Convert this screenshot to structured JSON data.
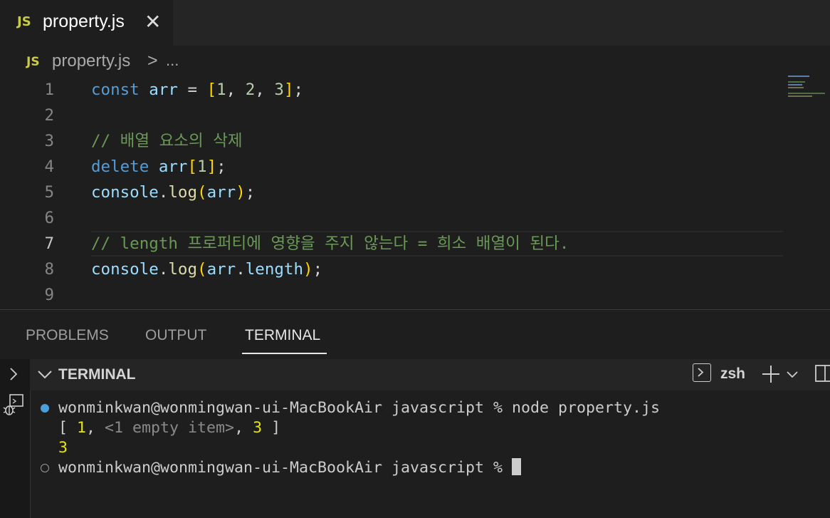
{
  "tab": {
    "badge": "JS",
    "filename": "property.js"
  },
  "breadcrumb": {
    "badge": "JS",
    "file": "property.js",
    "separator": ">",
    "more": "..."
  },
  "editor": {
    "line_numbers": [
      "1",
      "2",
      "3",
      "4",
      "5",
      "6",
      "7",
      "8",
      "9"
    ],
    "active_line": "7",
    "lines": {
      "l1": {
        "kw": "const",
        "var": "arr",
        "op": " = ",
        "b1": "[",
        "n1": "1",
        "c1": ", ",
        "n2": "2",
        "c2": ", ",
        "n3": "3",
        "b2": "]",
        "semi": ";"
      },
      "l3": {
        "comment": "// 배열 요소의 삭제"
      },
      "l4": {
        "kw": "delete",
        "var": "arr",
        "b1": "[",
        "n1": "1",
        "b2": "]",
        "semi": ";"
      },
      "l5": {
        "obj": "console",
        "dot": ".",
        "fn": "log",
        "b1": "(",
        "arg": "arr",
        "b2": ")",
        "semi": ";"
      },
      "l7": {
        "comment": "// length 프로퍼티에 영향을 주지 않는다 = 희소 배열이 된다."
      },
      "l8": {
        "obj": "console",
        "dot": ".",
        "fn": "log",
        "b1": "(",
        "arg": "arr",
        "dot2": ".",
        "prop": "length",
        "b2": ")",
        "semi": ";"
      }
    }
  },
  "panel": {
    "tabs": {
      "problems": "PROBLEMS",
      "output": "OUTPUT",
      "terminal": "TERMINAL"
    },
    "header": {
      "title": "TERMINAL",
      "shell": "zsh"
    }
  },
  "terminal": {
    "line1": {
      "prompt": "wonminkwan@wonmingwan-ui-MacBookAir javascript % ",
      "command": "node property.js"
    },
    "line2": {
      "open": "[ ",
      "v1": "1",
      "sep1": ", ",
      "empty": "<1 empty item>",
      "sep2": ", ",
      "v3": "3",
      "close": " ]"
    },
    "line3": "3",
    "line4": {
      "prompt": "wonminkwan@wonmingwan-ui-MacBookAir javascript % "
    }
  },
  "colors": {
    "accent_blue": "#4a9fd8",
    "keyword": "#569cd6",
    "comment": "#6a9955",
    "number_output": "#e5e510"
  }
}
